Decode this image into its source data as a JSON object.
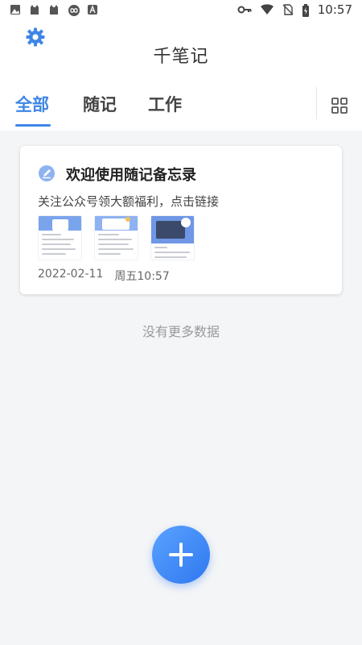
{
  "status_bar": {
    "time": "10:57",
    "left_icons": [
      "image-icon",
      "cat-icon",
      "cat-icon",
      "loop-icon",
      "a-icon"
    ],
    "right_icons": [
      "key-icon",
      "wifi-icon",
      "no-sim-icon",
      "battery-icon"
    ]
  },
  "header": {
    "title": "千笔记",
    "settings_icon": "gear-icon"
  },
  "tabs": [
    {
      "label": "全部",
      "active": true
    },
    {
      "label": "随记",
      "active": false
    },
    {
      "label": "工作",
      "active": false
    }
  ],
  "view_toggle_icon": "grid-icon",
  "note": {
    "title": "欢迎使用随记备忘录",
    "preview": "关注公众号领大额福利，点击链接",
    "date": "2022-02-11",
    "weekday_time": "周五10:57",
    "icon": "pen-icon"
  },
  "footer_text": "没有更多数据",
  "fab_icon": "plus-icon",
  "colors": {
    "accent": "#3e86e6",
    "background": "#f4f5f7",
    "fab_start": "#5aa2ff",
    "fab_end": "#2f78f0"
  }
}
